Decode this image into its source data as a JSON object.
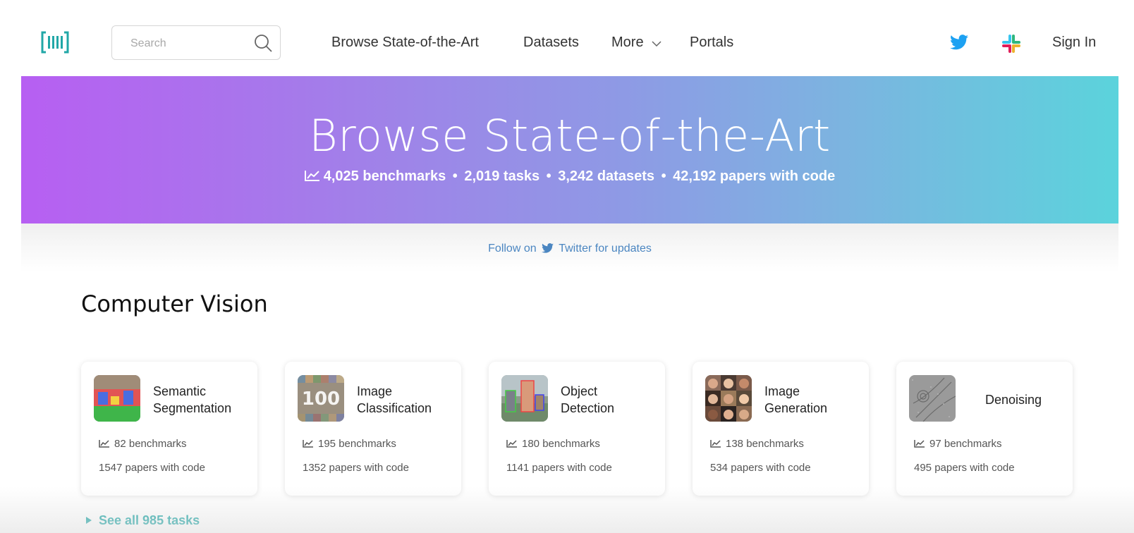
{
  "nav": {
    "search_placeholder": "Search",
    "links": [
      "Browse State-of-the-Art",
      "Datasets",
      "More",
      "Portals"
    ],
    "sign_in": "Sign In"
  },
  "hero": {
    "title": "Browse State-of-the-Art",
    "benchmarks": "4,025 benchmarks",
    "tasks": "2,019 tasks",
    "datasets": "3,242 datasets",
    "papers": "42,192 papers with code",
    "separator": "•"
  },
  "follow": {
    "prefix": "Follow on",
    "suffix": "Twitter for updates"
  },
  "section": {
    "title": "Computer Vision",
    "cards": [
      {
        "name_line1": "Semantic",
        "name_line2": "Segmentation",
        "benchmarks": "82 benchmarks",
        "papers": "1547 papers with code",
        "thumb_icon": "semantic-segmentation-thumb"
      },
      {
        "name_line1": "Image",
        "name_line2": "Classification",
        "benchmarks": "195 benchmarks",
        "papers": "1352 papers with code",
        "thumb_icon": "image-classification-thumb"
      },
      {
        "name_line1": "Object",
        "name_line2": "Detection",
        "benchmarks": "180 benchmarks",
        "papers": "1141 papers with code",
        "thumb_icon": "object-detection-thumb"
      },
      {
        "name_line1": "Image",
        "name_line2": "Generation",
        "benchmarks": "138 benchmarks",
        "papers": "534 papers with code",
        "thumb_icon": "image-generation-thumb"
      },
      {
        "name_line1": "Denoising",
        "name_line2": "",
        "benchmarks": "97 benchmarks",
        "papers": "495 papers with code",
        "thumb_icon": "denoising-thumb"
      }
    ],
    "see_all": "See all 985 tasks"
  },
  "colors": {
    "accent_teal": "#21a7a7",
    "twitter_blue": "#1da1f2",
    "hero_gradient_start": "#b75ff2",
    "hero_gradient_end": "#5bd3dc",
    "follow_link": "#4b86c1"
  }
}
